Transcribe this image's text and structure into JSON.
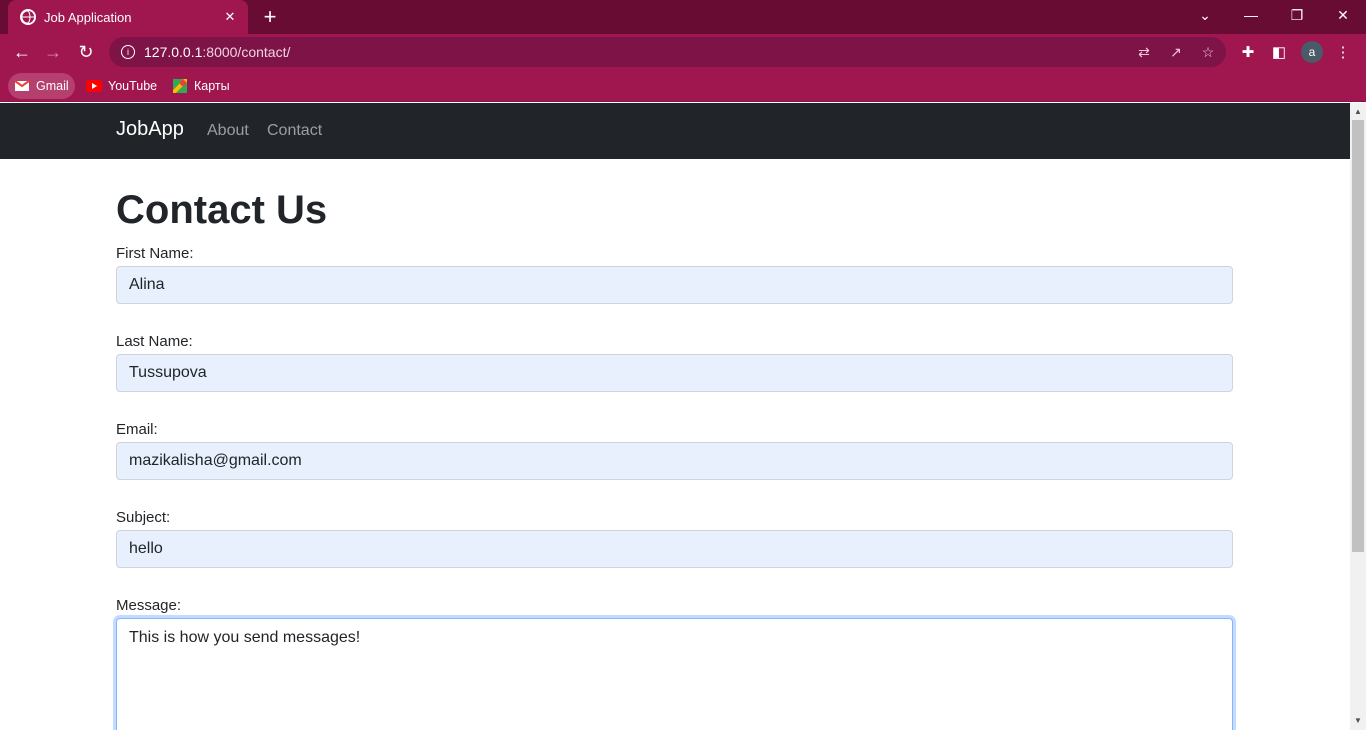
{
  "browser": {
    "tab_title": "Job Application",
    "url_host": "127.0.0.1",
    "url_rest": ":8000/contact/",
    "profile_initial": "a",
    "bookmarks": [
      "Gmail",
      "YouTube",
      "Карты"
    ],
    "colors": {
      "tabbar": "#690c33",
      "toolbar": "#a0174f"
    }
  },
  "navbar": {
    "brand": "JobApp",
    "links": [
      "About",
      "Contact"
    ]
  },
  "page": {
    "title": "Contact Us",
    "fields": [
      {
        "label": "First Name:",
        "value": "Alina"
      },
      {
        "label": "Last Name:",
        "value": "Tussupova"
      },
      {
        "label": "Email:",
        "value": "mazikalisha@gmail.com"
      },
      {
        "label": "Subject:",
        "value": "hello"
      }
    ],
    "message": {
      "label": "Message:",
      "value": "This is how you send messages!"
    }
  }
}
